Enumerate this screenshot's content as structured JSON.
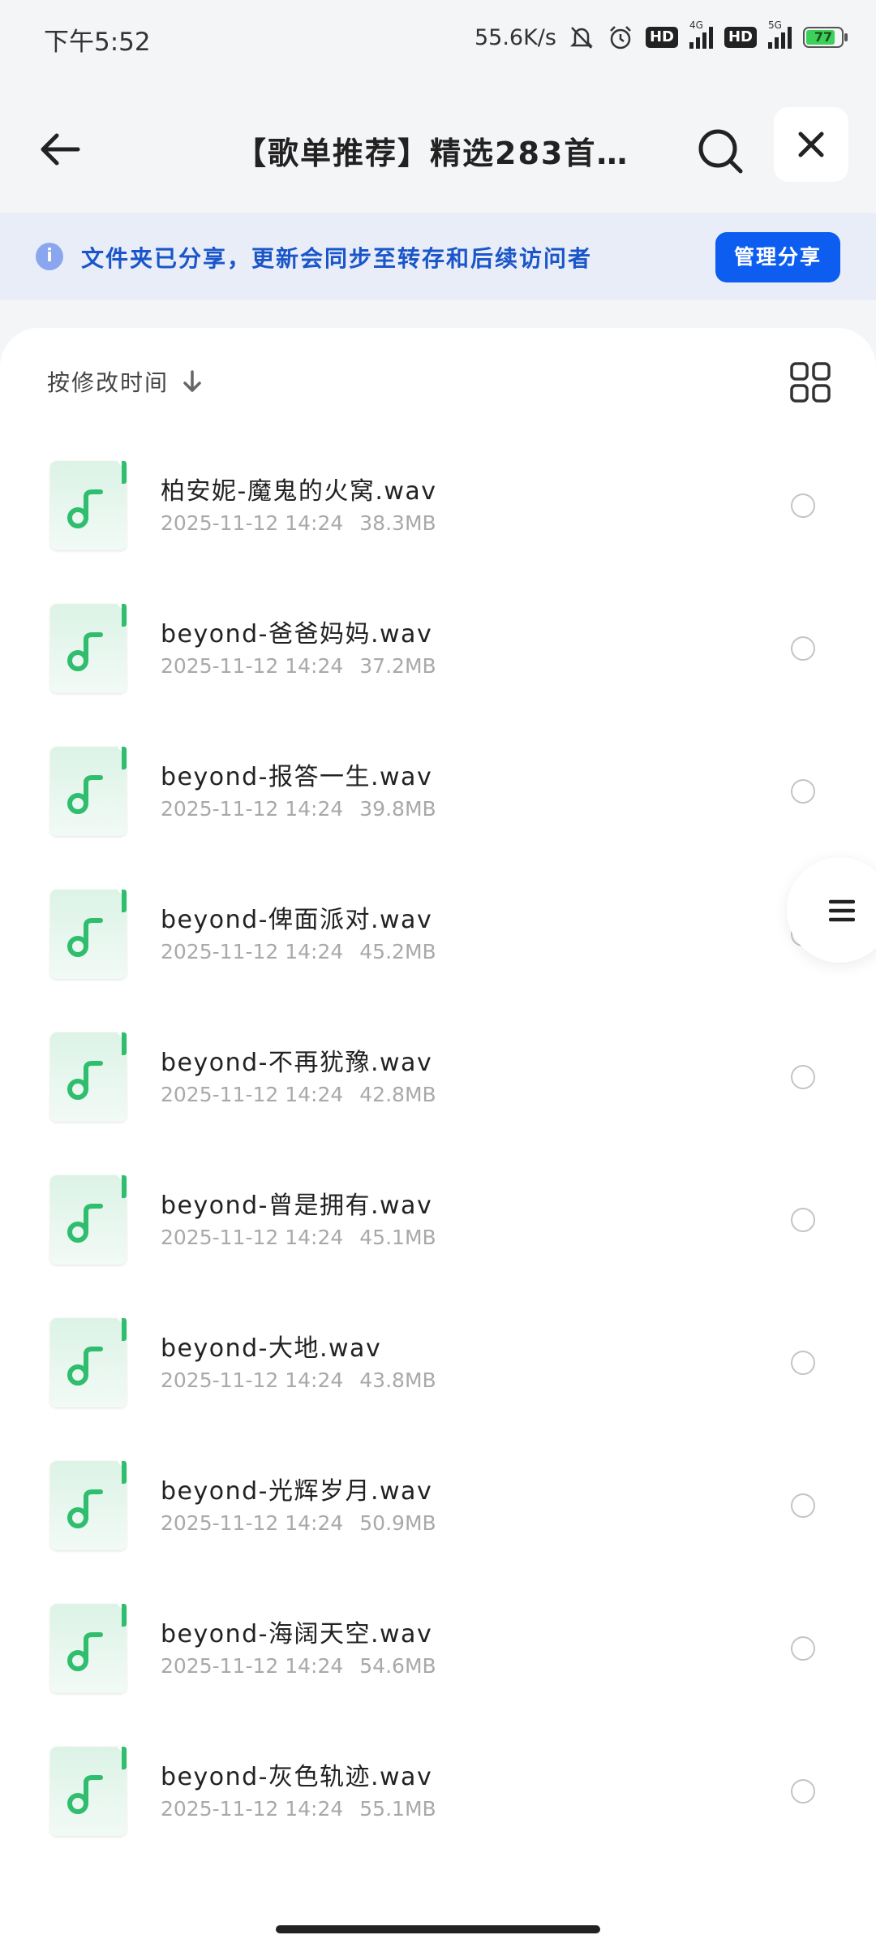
{
  "status_bar": {
    "time": "下午5:52",
    "net_speed": "55.6K/s",
    "hd1": "HD",
    "hd2": "HD",
    "net1": "4G",
    "net2": "5G",
    "battery": "77"
  },
  "header": {
    "title": "【歌单推荐】精选283首…"
  },
  "notice": {
    "message": "文件夹已分享，更新会同步至转存和后续访问者",
    "button": "管理分享"
  },
  "sort": {
    "label": "按修改时间"
  },
  "files": [
    {
      "name": "柏安妮-魔鬼的火窝.wav",
      "date": "2025-11-12 14:24",
      "size": "38.3MB"
    },
    {
      "name": "beyond-爸爸妈妈.wav",
      "date": "2025-11-12 14:24",
      "size": "37.2MB"
    },
    {
      "name": "beyond-报答一生.wav",
      "date": "2025-11-12 14:24",
      "size": "39.8MB"
    },
    {
      "name": "beyond-俾面派对.wav",
      "date": "2025-11-12 14:24",
      "size": "45.2MB"
    },
    {
      "name": "beyond-不再犹豫.wav",
      "date": "2025-11-12 14:24",
      "size": "42.8MB"
    },
    {
      "name": "beyond-曾是拥有.wav",
      "date": "2025-11-12 14:24",
      "size": "45.1MB"
    },
    {
      "name": "beyond-大地.wav",
      "date": "2025-11-12 14:24",
      "size": "43.8MB"
    },
    {
      "name": "beyond-光辉岁月.wav",
      "date": "2025-11-12 14:24",
      "size": "50.9MB"
    },
    {
      "name": "beyond-海阔天空.wav",
      "date": "2025-11-12 14:24",
      "size": "54.6MB"
    },
    {
      "name": "beyond-灰色轨迹.wav",
      "date": "2025-11-12 14:24",
      "size": "55.1MB"
    }
  ],
  "icons": {
    "file": "music-note-icon",
    "back": "arrow-left-icon",
    "search": "search-icon",
    "close": "close-icon",
    "grid": "grid-view-icon",
    "menu": "menu-icon",
    "info": "info-icon",
    "sort": "arrow-down-icon"
  },
  "colors": {
    "accent": "#0d5ef0",
    "notice_text": "#1a56c9",
    "music_green": "#2fbe6e"
  }
}
